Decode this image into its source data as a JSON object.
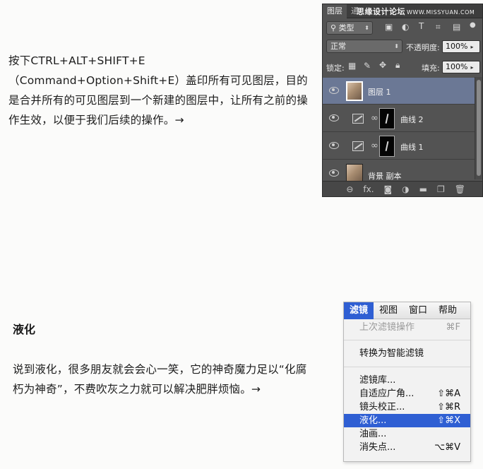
{
  "article": {
    "para1": "按下CTRL+ALT+SHIFT+E（Command+Option+Shift+E）盖印所有可见图层，目的是合并所有的可见图层到一个新建的图层中，让所有之前的操作生效，以便于我们后续的操作。→",
    "section2_heading": "液化",
    "para2": "说到液化，很多朋友就会会心一笑，它的神奇魔力足以“化腐朽为神奇”，不费吹灰之力就可以解决肥胖烦恼。→"
  },
  "layers_panel": {
    "tabs": [
      "图层",
      "通"
    ],
    "watermark": "思缘设计论坛",
    "watermark_small": "WWW.MISSYUAN.COM",
    "filter_type": "类型",
    "blend_mode": "正常",
    "opacity_label": "不透明度:",
    "opacity_value": "100%",
    "lock_label": "锁定:",
    "fill_label": "填充:",
    "fill_value": "100%",
    "layers": [
      {
        "name": "图层 1"
      },
      {
        "name": "曲线 2"
      },
      {
        "name": "曲线 1"
      },
      {
        "name": "背景 副本"
      }
    ],
    "bottom_fx": "fx."
  },
  "filter_menu": {
    "menubar": [
      "滤镜",
      "视图",
      "窗口",
      "帮助"
    ],
    "last_filter": {
      "label": "上次滤镜操作",
      "shortcut": "⌘F"
    },
    "smart_filter": "转换为智能滤镜",
    "items": [
      {
        "label": "滤镜库...",
        "shortcut": ""
      },
      {
        "label": "自适应广角...",
        "shortcut": "⇧⌘A"
      },
      {
        "label": "镜头校正...",
        "shortcut": "⇧⌘R"
      },
      {
        "label": "液化...",
        "shortcut": "⇧⌘X"
      },
      {
        "label": "油画...",
        "shortcut": ""
      },
      {
        "label": "消失点...",
        "shortcut": "⌥⌘V"
      }
    ]
  },
  "colors": {
    "menu_highlight": "#2f5fd3",
    "panel_bg": "#535353",
    "layer_selected": "#6b7895"
  }
}
